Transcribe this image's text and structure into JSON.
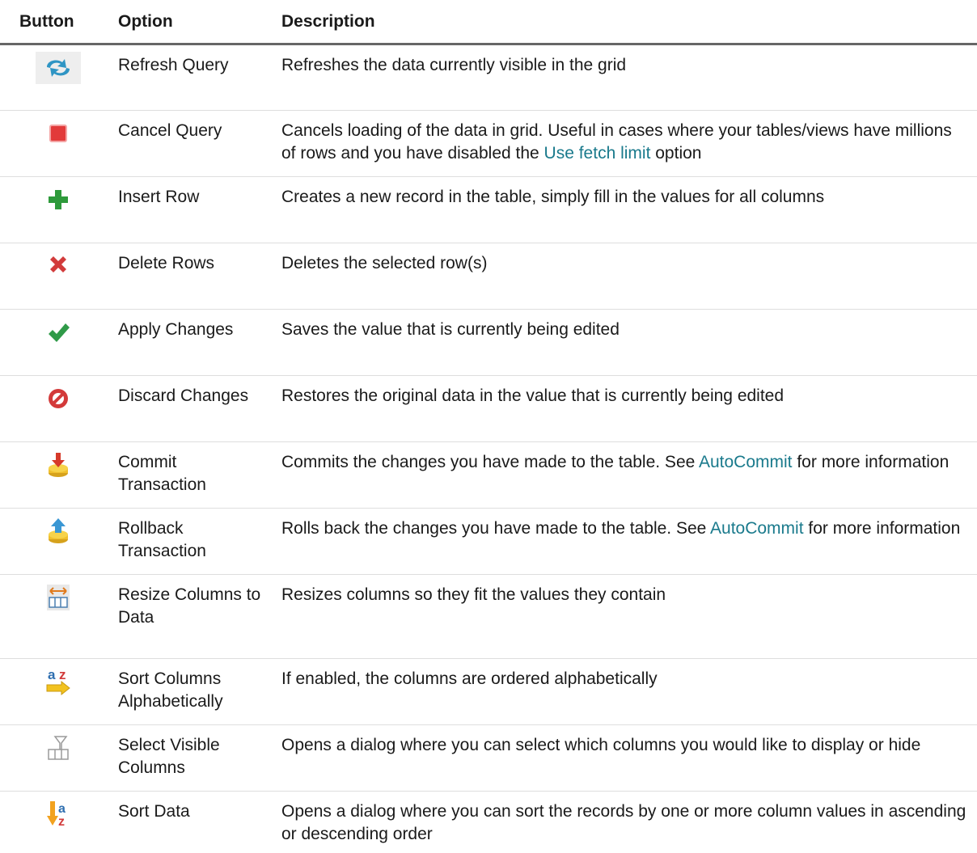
{
  "headers": {
    "button": "Button",
    "option": "Option",
    "description": "Description"
  },
  "rows": [
    {
      "icon": "refresh-icon",
      "option": "Refresh Query",
      "desc_before": "Refreshes the data currently visible in the grid",
      "link": "",
      "desc_after": ""
    },
    {
      "icon": "stop-icon",
      "option": "Cancel Query",
      "desc_before": "Cancels loading of the data in grid. Useful in cases where your tables/views have millions of rows and you have disabled the ",
      "link": "Use fetch limit",
      "desc_after": " option"
    },
    {
      "icon": "plus-icon",
      "option": "Insert Row",
      "desc_before": "Creates a new record in the table, simply fill in the values for all columns",
      "link": "",
      "desc_after": ""
    },
    {
      "icon": "delete-x-icon",
      "option": "Delete Rows",
      "desc_before": "Deletes the selected row(s)",
      "link": "",
      "desc_after": ""
    },
    {
      "icon": "checkmark-icon",
      "option": "Apply Changes",
      "desc_before": "Saves the value that is currently being edited",
      "link": "",
      "desc_after": ""
    },
    {
      "icon": "prohibited-icon",
      "option": "Discard Changes",
      "desc_before": "Restores the original data in the value that is currently being edited",
      "link": "",
      "desc_after": ""
    },
    {
      "icon": "commit-icon",
      "option": "Commit Transaction",
      "desc_before": "Commits the changes you have made to the table. See ",
      "link": "AutoCommit",
      "desc_after": " for more information"
    },
    {
      "icon": "rollback-icon",
      "option": "Rollback Transaction",
      "desc_before": "Rolls back the changes you have made to the table. See ",
      "link": "AutoCommit",
      "desc_after": " for more information"
    },
    {
      "icon": "resize-columns-icon",
      "option": "Resize Columns to Data",
      "desc_before": "Resizes columns so they fit the values they contain",
      "link": "",
      "desc_after": ""
    },
    {
      "icon": "sort-alpha-icon",
      "option": "Sort Columns Alphabetically",
      "desc_before": "If enabled, the columns are ordered alphabetically",
      "link": "",
      "desc_after": ""
    },
    {
      "icon": "filter-columns-icon",
      "option": "Select Visible Columns",
      "desc_before": "Opens a dialog where you can select which columns you would like to display or hide",
      "link": "",
      "desc_after": ""
    },
    {
      "icon": "sort-data-icon",
      "option": "Sort Data",
      "desc_before": "Opens a dialog where you can sort the records by one or more column values in ascending or descending order",
      "link": "",
      "desc_after": ""
    }
  ],
  "colors": {
    "link": "#1a7a8c",
    "header_rule": "#666666",
    "row_rule": "#dedede"
  }
}
